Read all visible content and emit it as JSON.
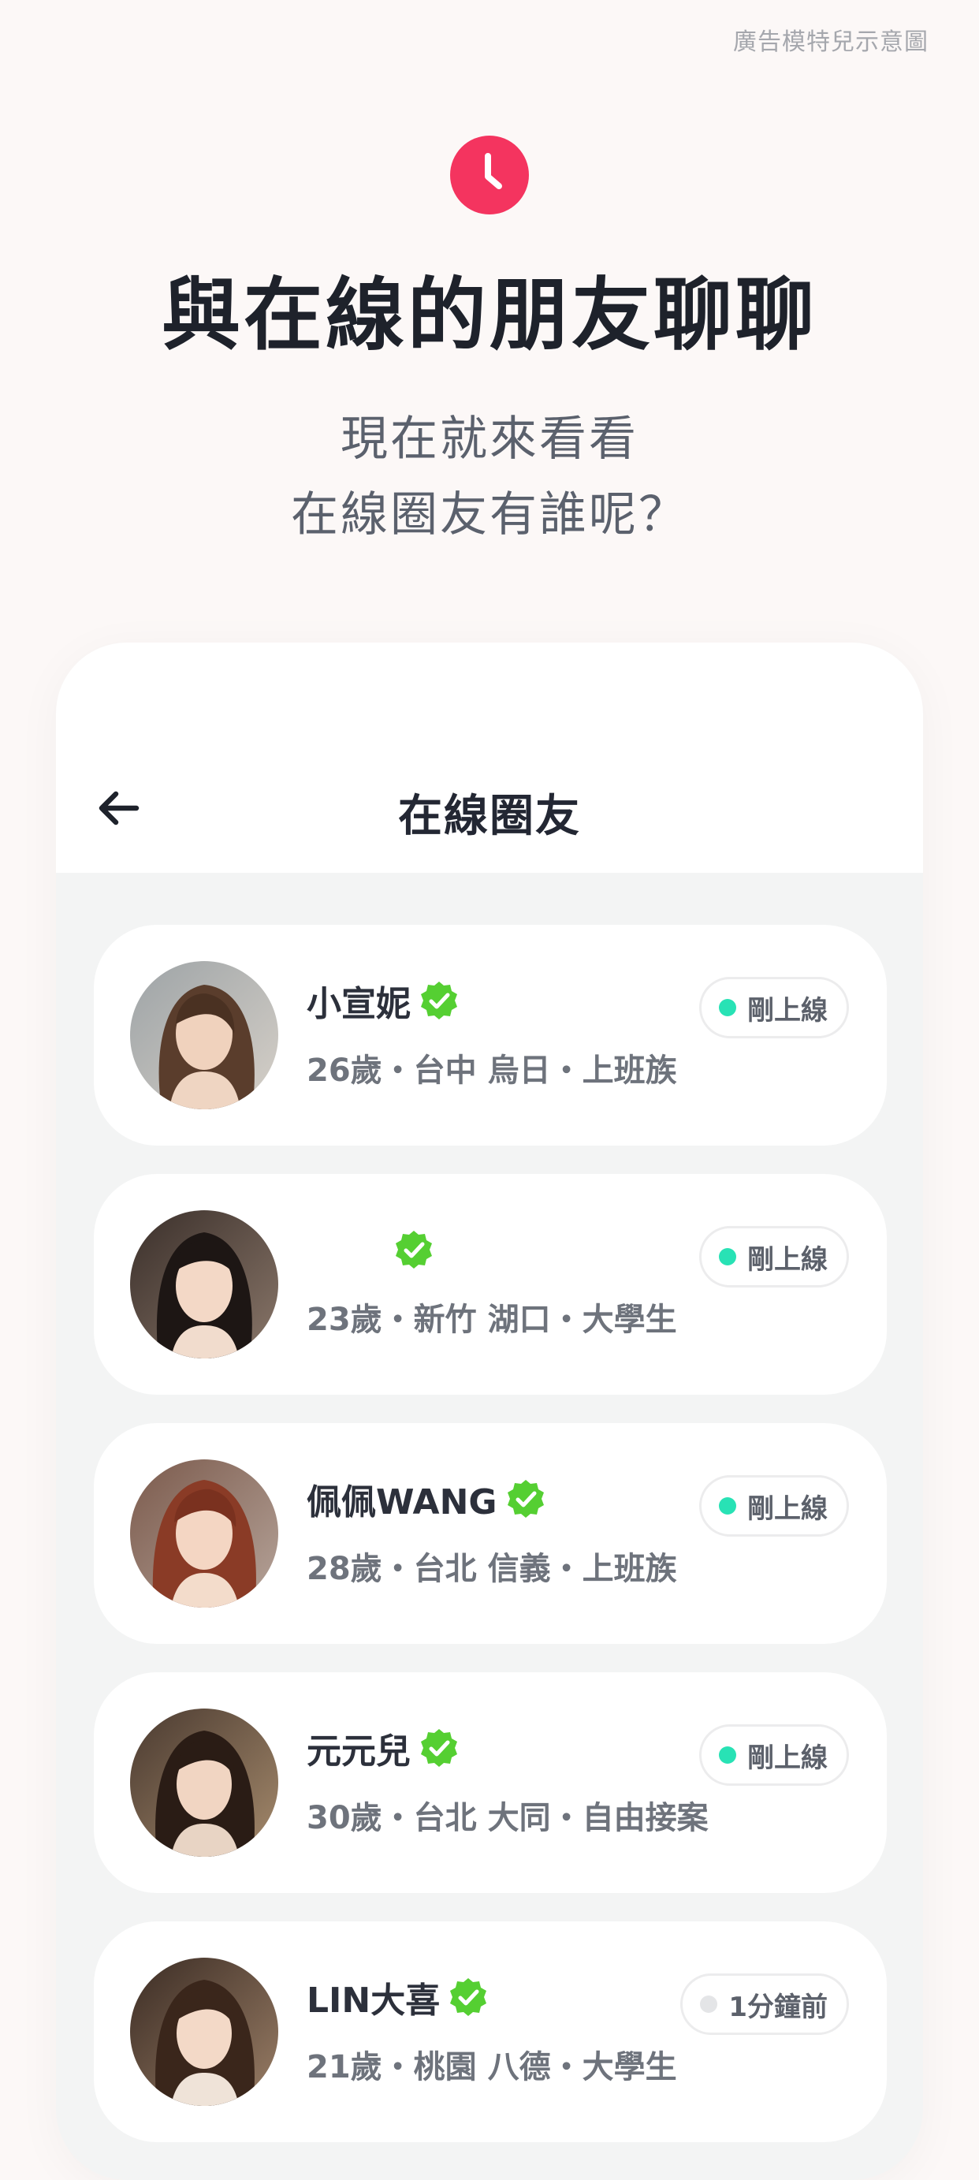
{
  "ad_label": "廣告模特兒示意圖",
  "colors": {
    "accent": "#f4345f",
    "online": "#28e2b5",
    "offline": "#e4e5e7",
    "verified": "#55cf32"
  },
  "hero": {
    "clock_icon": "clock-icon",
    "title": "與在線的朋友聊聊",
    "subtitle_line1": "現在就來看看",
    "subtitle_line2": "在線圈友有誰呢？"
  },
  "phone": {
    "back_icon": "arrow-left-icon",
    "title": "在線圈友",
    "users": [
      {
        "name": "小宣妮",
        "details": "26歲・台中 烏日・上班族",
        "status": "剛上線",
        "online": true
      },
      {
        "name": "",
        "details": "23歲・新竹 湖口・大學生",
        "status": "剛上線",
        "online": true
      },
      {
        "name": "佩佩WANG",
        "details": "28歲・台北 信義・上班族",
        "status": "剛上線",
        "online": true
      },
      {
        "name": "元元兒",
        "details": "30歲・台北 大同・自由接案",
        "status": "剛上線",
        "online": true
      },
      {
        "name": "LIN大喜",
        "details": "21歲・桃園 八德・大學生",
        "status": "1分鐘前",
        "online": false
      }
    ]
  }
}
